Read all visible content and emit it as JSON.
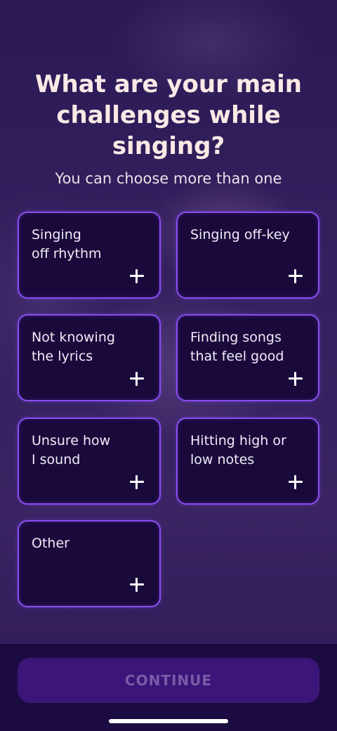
{
  "header": {
    "title": "What are your main\nchallenges while\nsinging?",
    "subtitle": "You can choose more than one"
  },
  "options": [
    {
      "label": "Singing\noff rhythm",
      "icon": "plus-icon"
    },
    {
      "label": "Singing off-key",
      "icon": "plus-icon"
    },
    {
      "label": "Not knowing\nthe lyrics",
      "icon": "plus-icon"
    },
    {
      "label": "Finding songs\nthat feel good",
      "icon": "plus-icon"
    },
    {
      "label": "Unsure how\nI sound",
      "icon": "plus-icon"
    },
    {
      "label": "Hitting high or\nlow notes",
      "icon": "plus-icon"
    },
    {
      "label": "Other",
      "icon": "plus-icon"
    }
  ],
  "footer": {
    "continue_label": "CONTINUE"
  },
  "colors": {
    "card_border": "#8a4df0",
    "card_background": "#1a0a3c",
    "continue_background": "#3b1678",
    "continue_text": "#7b5aa8"
  }
}
